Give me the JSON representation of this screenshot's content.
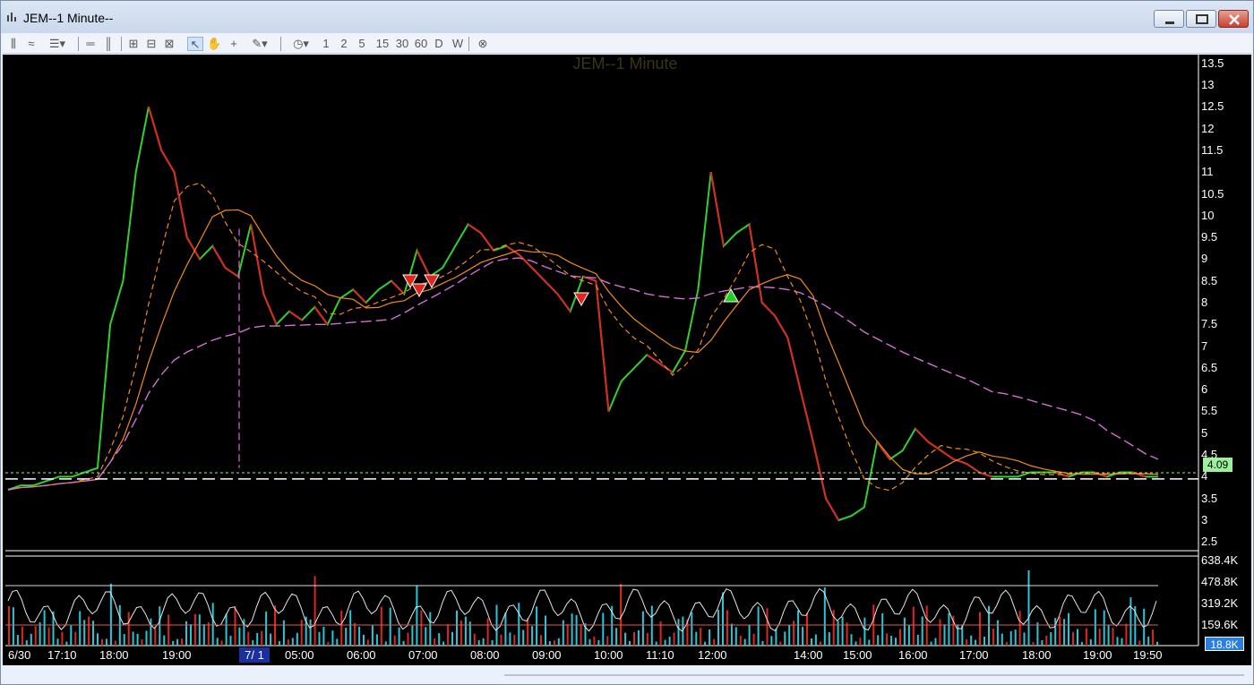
{
  "window": {
    "title": "JEM--1 Minute--"
  },
  "toolbar": {
    "intervals": [
      "1",
      "2",
      "5",
      "15",
      "30",
      "60",
      "D",
      "W"
    ]
  },
  "chart": {
    "title": "JEM--1 Minute",
    "last_price": "4.09",
    "last_volume": "18.8K",
    "date_start": "6/30",
    "date_mark": "7/ 1"
  },
  "chart_data": {
    "type": "line",
    "title": "JEM--1 Minute",
    "price_ticks": [
      "13.5",
      "13",
      "12.5",
      "12",
      "11.5",
      "11",
      "10.5",
      "10",
      "9.5",
      "9",
      "8.5",
      "8",
      "7.5",
      "7",
      "6.5",
      "6",
      "5.5",
      "5",
      "4.5",
      "4",
      "3.5",
      "3",
      "2.5"
    ],
    "volume_ticks": [
      "638.4K",
      "478.8K",
      "319.2K",
      "159.6K"
    ],
    "time_labels": [
      "6/30",
      "17:10",
      "18:00",
      "19:00",
      "7/ 1",
      "05:00",
      "06:00",
      "07:00",
      "08:00",
      "09:00",
      "10:00",
      "11:10",
      "12:00",
      "14:00",
      "15:00",
      "16:00",
      "17:00",
      "18:00",
      "19:00",
      "19:50"
    ],
    "ylim": [
      2.3,
      13.7
    ],
    "price_series": {
      "name": "",
      "x": [
        0,
        1,
        2,
        3,
        4,
        5,
        6,
        7,
        8,
        9,
        10,
        11,
        12,
        13,
        14,
        15,
        16,
        17,
        18,
        19,
        20,
        21,
        22,
        23,
        24,
        25,
        26,
        27,
        28,
        29,
        30,
        31,
        32,
        33,
        34,
        35,
        36,
        37,
        38,
        39,
        40,
        41,
        42,
        43,
        44,
        45,
        46,
        47,
        48,
        49,
        50,
        51,
        52,
        53,
        54,
        55,
        56,
        57,
        58,
        59,
        60,
        61,
        62,
        63,
        64,
        65,
        66,
        67,
        68,
        69,
        70,
        71,
        72,
        73,
        74,
        75,
        76,
        77,
        78,
        79,
        80,
        81,
        82,
        83,
        84,
        85,
        86,
        87,
        88,
        89,
        90
      ],
      "y": [
        3.7,
        3.8,
        3.8,
        3.9,
        4.0,
        4.0,
        4.1,
        4.2,
        7.5,
        8.5,
        11.0,
        12.5,
        11.5,
        11.0,
        9.5,
        9.0,
        9.3,
        8.8,
        8.6,
        9.8,
        8.2,
        7.5,
        7.8,
        7.6,
        7.9,
        7.5,
        8.1,
        8.3,
        8.0,
        8.3,
        8.5,
        8.2,
        9.2,
        8.6,
        8.8,
        9.3,
        9.8,
        9.6,
        9.2,
        9.3,
        9.1,
        8.8,
        8.5,
        8.2,
        7.8,
        8.6,
        8.5,
        5.5,
        6.2,
        6.5,
        6.8,
        6.6,
        6.4,
        6.9,
        8.3,
        11.0,
        9.3,
        9.6,
        9.8,
        8.0,
        7.7,
        7.2,
        6.0,
        4.8,
        3.5,
        3.0,
        3.1,
        3.3,
        4.8,
        4.4,
        4.6,
        5.1,
        4.8,
        4.6,
        4.4,
        4.3,
        4.1,
        4.0,
        4.0,
        4.0,
        4.1,
        4.1,
        4.1,
        4.0,
        4.1,
        4.1,
        4.0,
        4.1,
        4.1,
        4.0,
        4.0
      ]
    },
    "ylabel": "",
    "legend": "none",
    "grid": false
  }
}
